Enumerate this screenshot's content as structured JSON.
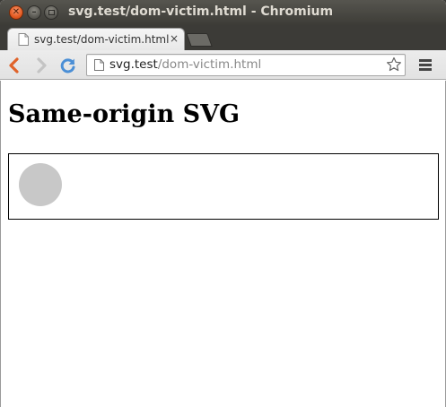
{
  "window": {
    "title": "svg.test/dom-victim.html - Chromium"
  },
  "tab": {
    "label": "svg.test/dom-victim.html",
    "close": "×"
  },
  "omnibox": {
    "host": "svg.test",
    "path": "/dom-victim.html"
  },
  "page": {
    "heading": "Same-origin SVG"
  },
  "icons": {
    "window_close": "close-icon",
    "window_minimize": "minimize-icon",
    "window_maximize": "maximize-icon",
    "tab_favicon": "page-icon",
    "back": "back-arrow-icon",
    "forward": "forward-arrow-icon",
    "reload": "reload-icon",
    "bookmark": "star-icon",
    "menu": "hamburger-menu-icon"
  },
  "colors": {
    "circle_fill": "#c8c8c8",
    "back_arrow": "#e0632a",
    "reload_arrow": "#4b8fd6"
  }
}
